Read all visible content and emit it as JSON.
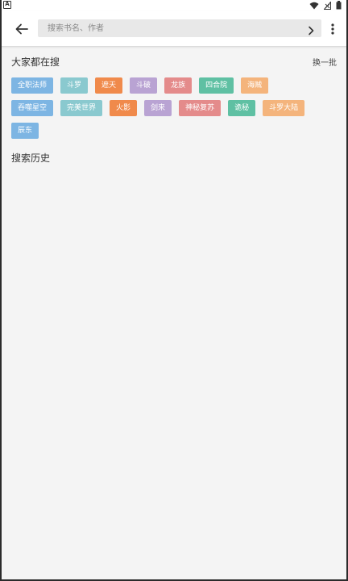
{
  "status_bar": {
    "left_icon": "A"
  },
  "header": {
    "search_placeholder": "搜索书名、作者"
  },
  "hot": {
    "title": "大家都在搜",
    "refresh_label": "换一批",
    "rows": [
      [
        {
          "label": "全职法师",
          "color": "#7db5e3"
        },
        {
          "label": "斗罗",
          "color": "#8ac9cf"
        },
        {
          "label": "遮天",
          "color": "#f08a4b"
        },
        {
          "label": "斗破",
          "color": "#b9a3d3"
        },
        {
          "label": "龙族",
          "color": "#e48b8b"
        },
        {
          "label": "四合院",
          "color": "#5fc0a3"
        },
        {
          "label": "海贼",
          "color": "#f4b47c"
        }
      ],
      [
        {
          "label": "吞噬星空",
          "color": "#7db5e3"
        },
        {
          "label": "完美世界",
          "color": "#8ac9cf"
        },
        {
          "label": "火影",
          "color": "#f08a4b"
        },
        {
          "label": "剑来",
          "color": "#b9a3d3"
        },
        {
          "label": "神秘复苏",
          "color": "#e48b8b"
        },
        {
          "label": "诡秘",
          "color": "#5fc0a3"
        },
        {
          "label": "斗罗大陆",
          "color": "#f4b47c"
        }
      ],
      [
        {
          "label": "辰东",
          "color": "#7db5e3"
        }
      ]
    ]
  },
  "history": {
    "title": "搜索历史"
  },
  "icons": [
    "back-arrow-icon",
    "chevron-right-icon",
    "more-vertical-icon",
    "wifi-icon",
    "no-signal-icon",
    "battery-icon"
  ]
}
